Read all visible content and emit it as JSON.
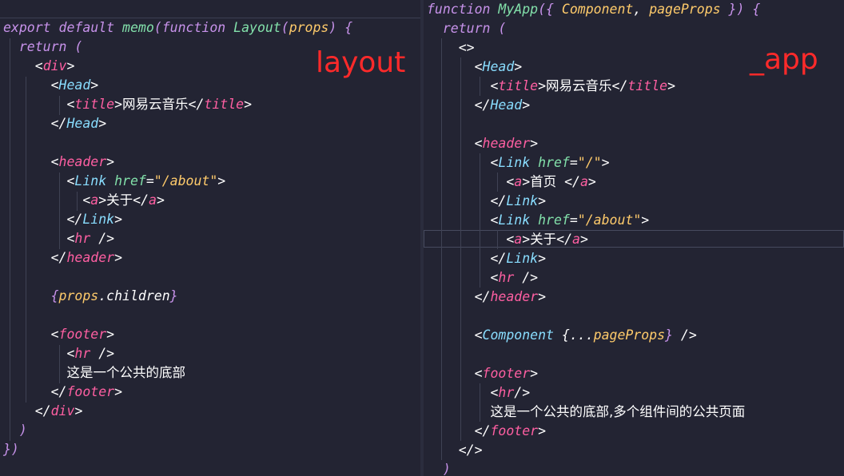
{
  "left_pane": {
    "label": "layout",
    "lines": [
      "export default memo(function Layout(props) {",
      "  return (",
      "    <div>",
      "      <Head>",
      "        <title>网易云音乐</title>",
      "      </Head>",
      "",
      "      <header>",
      "        <Link href=\"/about\">",
      "          <a>关于</a>",
      "        </Link>",
      "        <hr />",
      "      </header>",
      "",
      "      {props.children}",
      "",
      "      <footer>",
      "        <hr />",
      "        这是一个公共的底部",
      "      </footer>",
      "    </div>",
      "  )",
      "})"
    ]
  },
  "right_pane": {
    "label": "_app",
    "lines": [
      "function MyApp({ Component, pageProps }) {",
      "  return (",
      "    <>",
      "      <Head>",
      "        <title>网易云音乐</title>",
      "      </Head>",
      "",
      "      <header>",
      "        <Link href=\"/\">",
      "          <a>首页 </a>",
      "        </Link>",
      "        <Link href=\"/about\">",
      "          <a>关于</a>",
      "        </Link>",
      "        <hr />",
      "      </header>",
      "",
      "      <Component {...pageProps} />",
      "",
      "      <footer>",
      "        <hr/>",
      "        这是一个公共的底部,多个组件间的公共页面",
      "      </footer>",
      "    </>",
      "  )"
    ]
  }
}
